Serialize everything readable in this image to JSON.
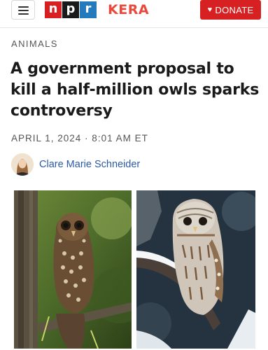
{
  "header": {
    "logo": {
      "n": "n",
      "p": "p",
      "r": "r"
    },
    "station": "KERA",
    "donate_label": "DONATE"
  },
  "article": {
    "section": "ANIMALS",
    "headline": "A government proposal to kill a half-million owls sparks controversy",
    "date": "APRIL 1, 2024 · 8:01 AM ET",
    "author": "Clare Marie Schneider"
  },
  "colors": {
    "npr_red": "#d62021",
    "npr_blue": "#237bbd",
    "kera_orange": "#e8493b",
    "byline_blue": "#2a5aa8"
  },
  "icons": [
    "menu-icon",
    "heart-icon"
  ]
}
